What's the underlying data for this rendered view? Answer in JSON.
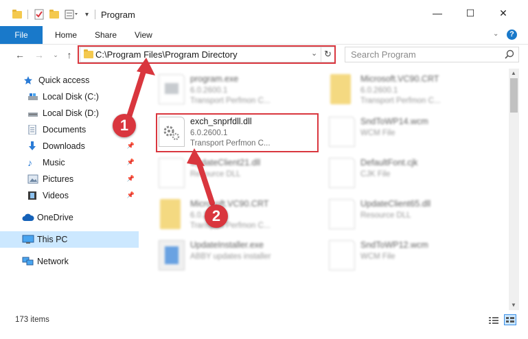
{
  "window": {
    "title": "Program",
    "controls": {
      "minimize": "—",
      "maximize": "☐",
      "close": "✕"
    }
  },
  "ribbon": {
    "tabs": [
      {
        "label": "File"
      },
      {
        "label": "Home"
      },
      {
        "label": "Share"
      },
      {
        "label": "View"
      }
    ],
    "help": "?"
  },
  "navigation": {
    "address": "C:\\Program Files\\Program Directory",
    "search_placeholder": "Search Program"
  },
  "sidebar": {
    "quick_access": "Quick access",
    "items": [
      {
        "label": "Local Disk (C:)"
      },
      {
        "label": "Local Disk (D:)"
      },
      {
        "label": "Documents"
      },
      {
        "label": "Downloads"
      },
      {
        "label": "Music"
      },
      {
        "label": "Pictures"
      },
      {
        "label": "Videos"
      }
    ],
    "onedrive": "OneDrive",
    "this_pc": "This PC",
    "network": "Network"
  },
  "files": [
    {
      "name": "program.exe",
      "version": "6.0.2600.1",
      "desc": "Transport Perfmon C..."
    },
    {
      "name": "Microsoft.VC90.CRT",
      "version": "6.0.2600.1",
      "desc": "Transport Perfmon C..."
    },
    {
      "name": "exch_snprfdll.dll",
      "version": "6.0.2600.1",
      "desc": "Transport Perfmon C..."
    },
    {
      "name": "SndToWP14.wcm",
      "version": "WCM File",
      "desc": ""
    },
    {
      "name": "UpdateClient21.dll",
      "version": "Resource DLL",
      "desc": ""
    },
    {
      "name": "DefaultFont.cjk",
      "version": "CJK File",
      "desc": ""
    },
    {
      "name": "Microsoft.VC90.CRT",
      "version": "6.0.2600.1",
      "desc": "Transport Perfmon C..."
    },
    {
      "name": "UpdateClient65.dll",
      "version": "Resource DLL",
      "desc": ""
    },
    {
      "name": "UpdateInstaller.exe",
      "version": "ABBY updates installer",
      "desc": ""
    },
    {
      "name": "SndToWP12.wcm",
      "version": "WCM File",
      "desc": ""
    }
  ],
  "status": {
    "count": "173 items"
  },
  "annotations": {
    "step1": "1",
    "step2": "2"
  },
  "colors": {
    "accent": "#1979ca",
    "highlight": "#d9363e",
    "selected_nav": "#cce8ff"
  }
}
